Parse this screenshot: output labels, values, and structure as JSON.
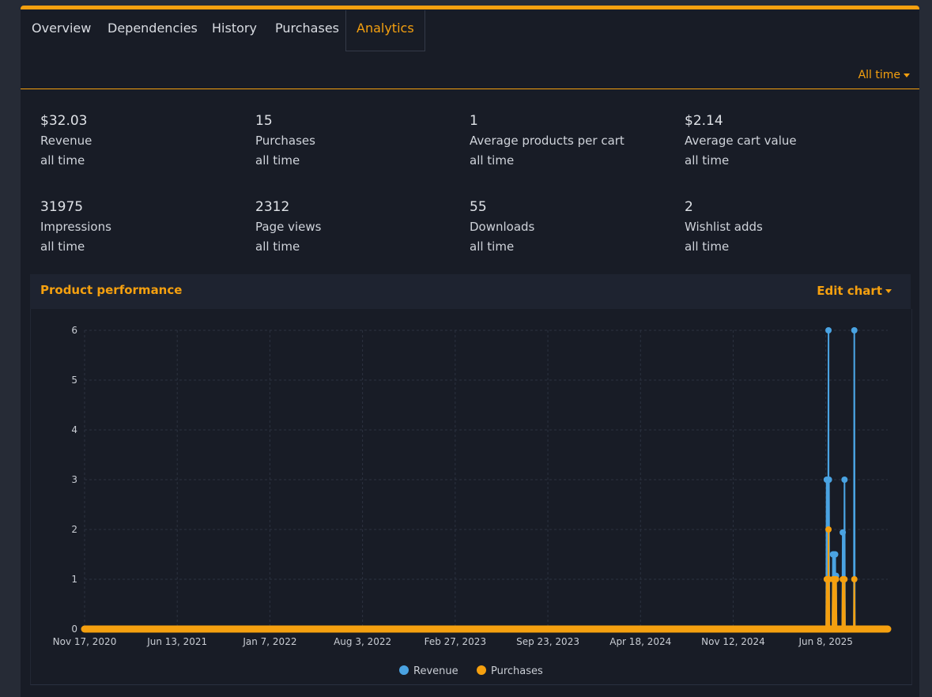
{
  "tabs": [
    {
      "label": "Overview"
    },
    {
      "label": "Dependencies"
    },
    {
      "label": "History"
    },
    {
      "label": "Purchases"
    },
    {
      "label": "Analytics"
    }
  ],
  "range": {
    "label": "All time"
  },
  "stats": [
    {
      "value": "$32.03",
      "label": "Revenue",
      "period": "all time"
    },
    {
      "value": "15",
      "label": "Purchases",
      "period": "all time"
    },
    {
      "value": "1",
      "label": "Average products per cart",
      "period": "all time"
    },
    {
      "value": "$2.14",
      "label": "Average cart value",
      "period": "all time"
    },
    {
      "value": "31975",
      "label": "Impressions",
      "period": "all time"
    },
    {
      "value": "2312",
      "label": "Page views",
      "period": "all time"
    },
    {
      "value": "55",
      "label": "Downloads",
      "period": "all time"
    },
    {
      "value": "2",
      "label": "Wishlist adds",
      "period": "all time"
    }
  ],
  "performance": {
    "title": "Product performance",
    "edit_label": "Edit chart"
  },
  "colors": {
    "accent": "#f5a00f",
    "revenue": "#4aa3e2",
    "purchases": "#f5a00f"
  },
  "chart_data": {
    "type": "line",
    "x_ticks": [
      "Nov 17, 2020",
      "Jun 13, 2021",
      "Jan 7, 2022",
      "Aug 3, 2022",
      "Feb 27, 2023",
      "Sep 23, 2023",
      "Apr 18, 2024",
      "Nov 12, 2024",
      "Jun 8, 2025"
    ],
    "y_ticks": [
      "0",
      "1",
      "2",
      "3",
      "4",
      "5",
      "6"
    ],
    "ylim": [
      0,
      6
    ],
    "x_range": [
      "2020-11-17",
      "2025-10-25"
    ],
    "legend_position": "bottom",
    "grid": true,
    "series": [
      {
        "name": "Revenue",
        "points": [
          {
            "x": "2025-06-10",
            "y": 3
          },
          {
            "x": "2025-06-11",
            "y": 1
          },
          {
            "x": "2025-06-14",
            "y": 6
          },
          {
            "x": "2025-06-15",
            "y": 3
          },
          {
            "x": "2025-06-24",
            "y": 1.5
          },
          {
            "x": "2025-06-26",
            "y": 1.5
          },
          {
            "x": "2025-06-29",
            "y": 1.5
          },
          {
            "x": "2025-07-01",
            "y": 1.07
          },
          {
            "x": "2025-07-16",
            "y": 1.94
          },
          {
            "x": "2025-07-20",
            "y": 3
          },
          {
            "x": "2025-08-11",
            "y": 6
          }
        ]
      },
      {
        "name": "Purchases",
        "points": [
          {
            "x": "2025-06-10",
            "y": 1
          },
          {
            "x": "2025-06-11",
            "y": 1
          },
          {
            "x": "2025-06-14",
            "y": 2
          },
          {
            "x": "2025-06-15",
            "y": 1
          },
          {
            "x": "2025-06-24",
            "y": 1
          },
          {
            "x": "2025-06-26",
            "y": 1
          },
          {
            "x": "2025-06-29",
            "y": 1
          },
          {
            "x": "2025-07-01",
            "y": 1
          },
          {
            "x": "2025-07-16",
            "y": 1
          },
          {
            "x": "2025-07-20",
            "y": 1
          },
          {
            "x": "2025-08-11",
            "y": 1
          }
        ]
      }
    ]
  }
}
